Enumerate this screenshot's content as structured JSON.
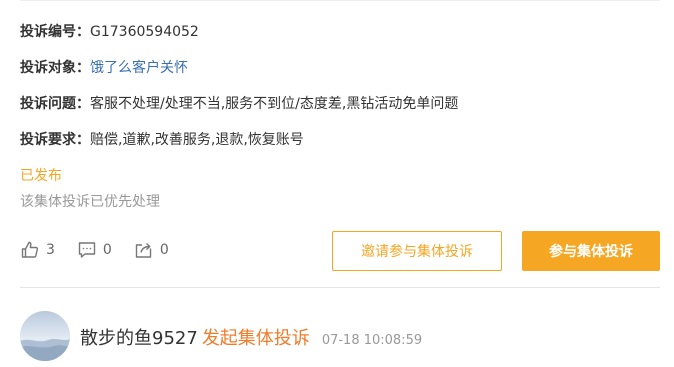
{
  "details": {
    "number_label": "投诉编号：",
    "number_value": "G17360594052",
    "target_label": "投诉对象：",
    "target_value": "饿了么客户关怀",
    "issue_label": "投诉问题：",
    "issue_value": "客服不处理/处理不当,服务不到位/态度差,黑钻活动免单问题",
    "request_label": "投诉要求：",
    "request_value": "赔偿,道歉,改善服务,退款,恢复账号"
  },
  "status": {
    "tag": "已发布",
    "note": "该集体投诉已优先处理"
  },
  "actions": {
    "like_count": "3",
    "comment_count": "0",
    "share_count": "0",
    "invite_label": "邀请参与集体投诉",
    "join_label": "参与集体投诉"
  },
  "author": {
    "name": "散步的鱼9527",
    "action": "发起集体投诉",
    "time": "07-18 10:08:59"
  },
  "colors": {
    "accent": "#f5a623",
    "link": "#3a6fb0",
    "highlight": "#f07c2b"
  },
  "icons": [
    "thumbs-up-icon",
    "comment-icon",
    "share-icon"
  ]
}
